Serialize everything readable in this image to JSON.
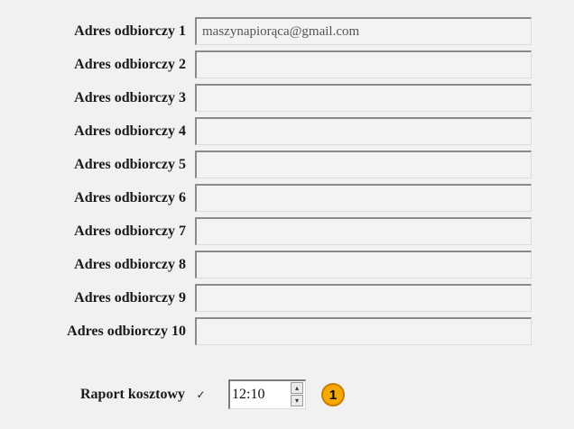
{
  "recipients": [
    {
      "label": "Adres odbiorczy 1",
      "value": "maszynapiorąca@gmail.com"
    },
    {
      "label": "Adres odbiorczy 2",
      "value": ""
    },
    {
      "label": "Adres odbiorczy 3",
      "value": ""
    },
    {
      "label": "Adres odbiorczy 4",
      "value": ""
    },
    {
      "label": "Adres odbiorczy 5",
      "value": ""
    },
    {
      "label": "Adres odbiorczy 6",
      "value": ""
    },
    {
      "label": "Adres odbiorczy 7",
      "value": ""
    },
    {
      "label": "Adres odbiorczy 8",
      "value": ""
    },
    {
      "label": "Adres odbiorczy 9",
      "value": ""
    },
    {
      "label": "Adres odbiorczy 10",
      "value": ""
    }
  ],
  "report": {
    "label": "Raport kosztowy",
    "checked": true,
    "check_glyph": "✓",
    "time": "12:10",
    "spin_up_glyph": "▴",
    "spin_down_glyph": "▾",
    "badge": "1"
  }
}
